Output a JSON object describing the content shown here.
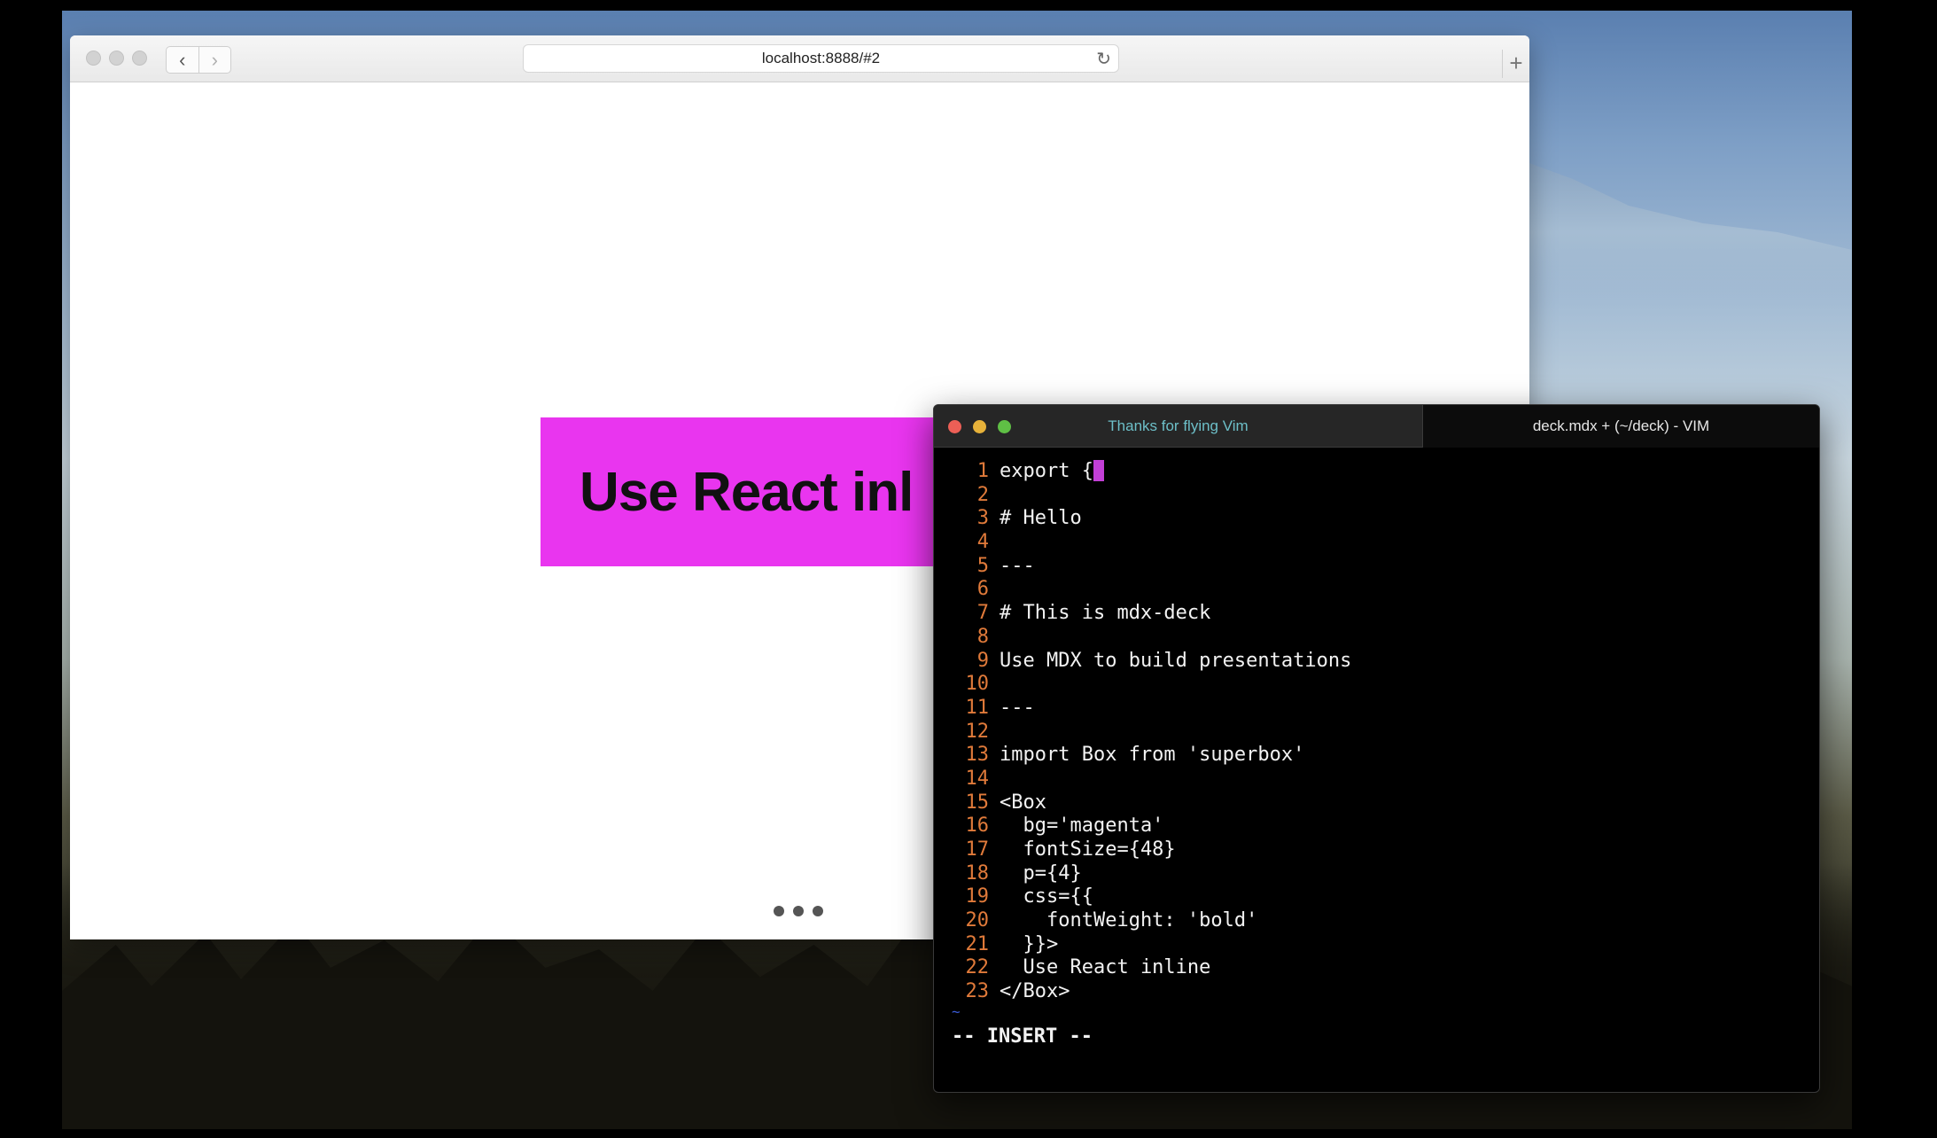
{
  "browser": {
    "url": "localhost:8888/#2",
    "back_icon": "‹",
    "forward_icon": "›",
    "reload_icon": "↻",
    "new_tab_icon": "+",
    "slide_text": "Use React inl"
  },
  "terminal": {
    "tab_inactive": "Thanks for flying Vim",
    "tab_active": "deck.mdx + (~/deck) - VIM",
    "lines": [
      {
        "n": "1",
        "t": "export {"
      },
      {
        "n": "2",
        "t": ""
      },
      {
        "n": "3",
        "t": "# Hello"
      },
      {
        "n": "4",
        "t": ""
      },
      {
        "n": "5",
        "t": "---"
      },
      {
        "n": "6",
        "t": ""
      },
      {
        "n": "7",
        "t": "# This is mdx-deck"
      },
      {
        "n": "8",
        "t": ""
      },
      {
        "n": "9",
        "t": "Use MDX to build presentations"
      },
      {
        "n": "10",
        "t": ""
      },
      {
        "n": "11",
        "t": "---"
      },
      {
        "n": "12",
        "t": ""
      },
      {
        "n": "13",
        "t": "import Box from 'superbox'"
      },
      {
        "n": "14",
        "t": ""
      },
      {
        "n": "15",
        "t": "<Box"
      },
      {
        "n": "16",
        "t": "  bg='magenta'"
      },
      {
        "n": "17",
        "t": "  fontSize={48}"
      },
      {
        "n": "18",
        "t": "  p={4}"
      },
      {
        "n": "19",
        "t": "  css={{"
      },
      {
        "n": "20",
        "t": "    fontWeight: 'bold'"
      },
      {
        "n": "21",
        "t": "  }}>"
      },
      {
        "n": "22",
        "t": "  Use React inline"
      },
      {
        "n": "23",
        "t": "</Box>"
      }
    ],
    "tilde": "~",
    "mode": "-- INSERT --"
  },
  "colors": {
    "slide_bg": "#e935ef",
    "line_number": "#e07a3a",
    "cursor": "#c23fd6",
    "inactive_tab_text": "#6dbfc8"
  }
}
